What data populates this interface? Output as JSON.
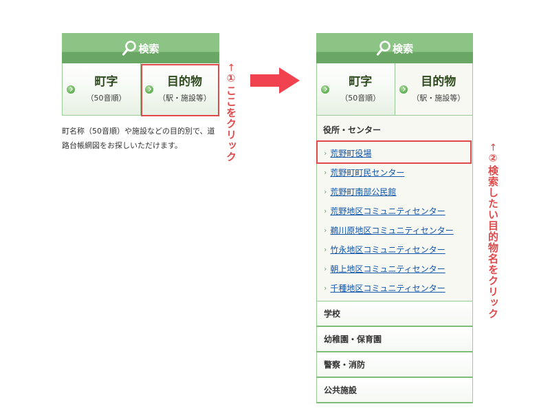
{
  "search_header": {
    "label": "検索"
  },
  "tabs": {
    "town": {
      "title": "町字",
      "sub": "（50音順）"
    },
    "facility": {
      "title": "目的物",
      "sub": "（駅・施設等）"
    }
  },
  "description": "町名称（50音順）や施設などの目的別で、道路台帳網図をお探しいただけます。",
  "annotations": {
    "step1": {
      "arrow": "←",
      "text": "①ここをクリック"
    },
    "step2": {
      "arrow": "←",
      "text": "②検索したい目的物名をクリック"
    }
  },
  "category_open": {
    "title": "役所・センター",
    "items": [
      "荒野町役場",
      "荒野町町民センター",
      "荒野町南部公民館",
      "荒野地区コミュニティセンター",
      "鵜川原地区コミュニティセンター",
      "竹永地区コミュニティセンター",
      "朝上地区コミュニティセンター",
      "千種地区コミュニティセンター"
    ]
  },
  "categories": [
    "学校",
    "幼稚園・保育園",
    "警察・消防",
    "公共施設"
  ],
  "icons": {
    "search": "magnifier-icon",
    "bullet": "green-circle-arrow-icon",
    "item": "chevron-right-icon",
    "flow_arrow": "right-arrow-icon"
  },
  "colors": {
    "header_green": "#8cc486",
    "header_dark": "#6aa664",
    "annotation_red": "#e04a4a",
    "link_blue": "#1155aa"
  }
}
